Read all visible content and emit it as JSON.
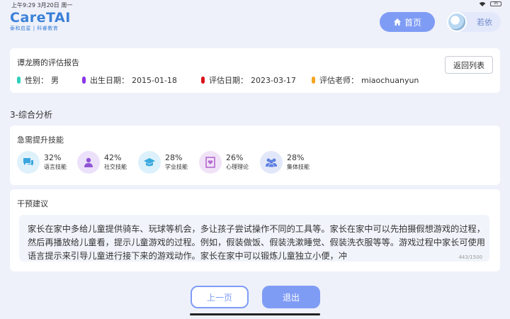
{
  "status": {
    "time": "上午9:29  3月20日 周一",
    "battery": "35"
  },
  "logo": {
    "brand": "CareTAI",
    "tagline": "泰和启星 | 科睿教育"
  },
  "header": {
    "home_label": "首页",
    "user_name": "若依"
  },
  "report": {
    "title": "谭龙腾的评估报告",
    "back_label": "返回列表",
    "info": [
      {
        "label": "性别：",
        "value": "男",
        "color": "#2ed1b8"
      },
      {
        "label": "出生日期：",
        "value": "2015-01-18",
        "color": "#8a37e6"
      },
      {
        "label": "评估日期：",
        "value": "2023-03-17",
        "color": "#d9141c"
      },
      {
        "label": "评估老师：",
        "value": "miaochuanyun",
        "color": "#f5a623"
      }
    ]
  },
  "section_title": "3-综合分析",
  "skills": {
    "title": "急需提升技能",
    "items": [
      {
        "pct": "32%",
        "label": "语言技能",
        "icon": "chat-icon",
        "bg": "#dff1fb",
        "fg": "#39a6e0"
      },
      {
        "pct": "42%",
        "label": "社交技能",
        "icon": "person-icon",
        "bg": "#ece1fa",
        "fg": "#8f55d6"
      },
      {
        "pct": "28%",
        "label": "学业技能",
        "icon": "graduation-cap-icon",
        "bg": "#dcf1fb",
        "fg": "#3aa9df"
      },
      {
        "pct": "26%",
        "label": "心理理论",
        "icon": "heart-frame-icon",
        "bg": "#f1e3f7",
        "fg": "#b46ad1"
      },
      {
        "pct": "28%",
        "label": "集体技能",
        "icon": "group-icon",
        "bg": "#e2e8fa",
        "fg": "#5d7ee0"
      }
    ]
  },
  "advice": {
    "title": "干预建议",
    "text": "家长在家中多给儿童提供骑车、玩球等机会，多让孩子尝试操作不同的工具等。家长在家中可以先拍摄假想游戏的过程，然后再播放给儿童看，提示儿童游戏的过程。例如，假装做饭、假装洗漱睡觉、假装洗衣服等等。游戏过程中家长可使用语言提示来引导儿童进行接下来的游戏动作。家长在家中可以锻炼儿童独立小便，冲",
    "counter": "443/1500"
  },
  "footer": {
    "prev_label": "上一页",
    "exit_label": "退出"
  }
}
